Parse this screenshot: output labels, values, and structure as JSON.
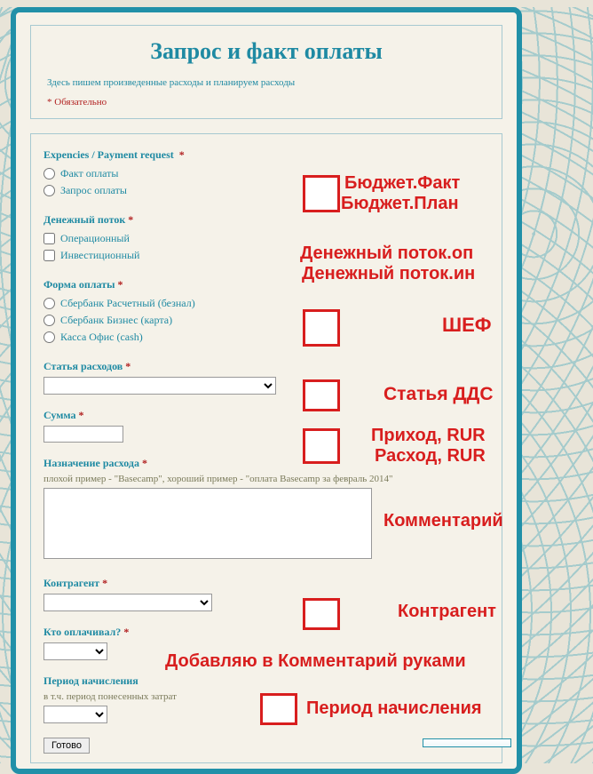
{
  "header": {
    "title": "Запрос и факт оплаты",
    "description": "Здесь пишем произведенные расходы и планируем расходы",
    "required_note": "* Обязательно"
  },
  "groups": {
    "expencies": {
      "label": "Expencies / Payment request",
      "req": "*",
      "options": [
        "Факт оплаты",
        "Запрос оплаты"
      ]
    },
    "cashflow": {
      "label": "Денежный поток",
      "req": "*",
      "options": [
        "Операционный",
        "Инвестиционный"
      ]
    },
    "payform": {
      "label": "Форма оплаты",
      "req": "*",
      "options": [
        "Сбербанк Расчетный (безнал)",
        "Сбербанк Бизнес (карта)",
        "Касса Офис (cash)"
      ]
    },
    "article": {
      "label": "Статья расходов",
      "req": "*"
    },
    "amount": {
      "label": "Сумма",
      "req": "*"
    },
    "purpose": {
      "label": "Назначение расхода",
      "req": "*",
      "hint": "плохой пример - \"Basecamp\", хороший пример - \"оплата Basecamp за февраль 2014\""
    },
    "contractor": {
      "label": "Контрагент",
      "req": "*"
    },
    "payer": {
      "label": "Кто оплачивал?",
      "req": "*"
    },
    "period": {
      "label": "Период начисления",
      "hint": "в т.ч. период понесенных затрат"
    }
  },
  "submit": {
    "label": "Готово"
  },
  "annotations": {
    "budget_fact": "Бюджет.Факт",
    "budget_plan": "Бюджет.План",
    "cashflow_op": "Денежный поток.оп",
    "cashflow_inv": "Денежный поток.ин",
    "chef": "ШЕФ",
    "article_dds": "Статья ДДС",
    "income": "Приход, RUR",
    "expense": "Расход, RUR",
    "comment": "Комментарий",
    "contractor": "Контрагент",
    "payer_note": "Добавляю в Комментарий руками",
    "period": "Период начисления"
  }
}
